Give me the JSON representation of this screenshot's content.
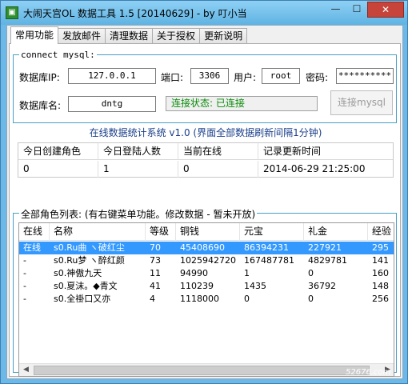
{
  "window": {
    "title": "大闹天宫OL 数据工具 1.5 [20140629] - by 叮小当",
    "min_glyph": "—",
    "max_glyph": "☐",
    "close_glyph": "✕"
  },
  "tabs": [
    {
      "label": "常用功能",
      "active": true
    },
    {
      "label": "发放邮件",
      "active": false
    },
    {
      "label": "清理数据",
      "active": false
    },
    {
      "label": "关于授权",
      "active": false
    },
    {
      "label": "更新说明",
      "active": false
    }
  ],
  "connect": {
    "legend": "connect mysql:",
    "ip_label": "数据库IP:",
    "ip_value": "127.0.0.1",
    "port_label": "端口:",
    "port_value": "3306",
    "user_label": "用户:",
    "user_value": "root",
    "password_label": "密码:",
    "password_value": "**********",
    "dbname_label": "数据库名:",
    "dbname_value": "dntg",
    "status_text": "连接状态: 已连接",
    "status_color": "#0a8c0a",
    "connect_button": "连接mysql"
  },
  "stats": {
    "title": "在线数据统计系统 v1.0 (界面全部数据刷新间隔1分钟)",
    "headers": [
      "今日创建角色",
      "今日登陆人数",
      "当前在线",
      "记录更新时间"
    ],
    "values": [
      "0",
      "1",
      "0",
      "2014-06-29 21:25:00"
    ]
  },
  "roles": {
    "legend": "全部角色列表: (有右键菜单功能。修改数据 - 暂未开放)",
    "headers": [
      "在线",
      "名称",
      "等级",
      "铜钱",
      "元宝",
      "礼金",
      "经验"
    ],
    "rows": [
      [
        "在线",
        "s0.Ru曲 ヽ破红尘",
        "70",
        "45408690",
        "86394231",
        "227921",
        "295"
      ],
      [
        "-",
        "s0.Ru梦 ヽ醉红颜",
        "73",
        "1025942720",
        "167487781",
        "4829781",
        "141"
      ],
      [
        "-",
        "s0.神傲九天",
        "11",
        "94990",
        "1",
        "0",
        "160"
      ],
      [
        "-",
        "s0.夏沫。◆青文",
        "41",
        "110239",
        "1435",
        "36792",
        "148"
      ],
      [
        "-",
        "s0.全褂口又亦",
        "4",
        "1118000",
        "0",
        "0",
        "256"
      ]
    ],
    "selected_row": 0
  },
  "watermark": "52676.com",
  "colors": {
    "title_bar": "#6cb8e6",
    "selection": "#3399ff",
    "group_border": "#4a9fc8",
    "stats_title": "#1a3f8a"
  }
}
